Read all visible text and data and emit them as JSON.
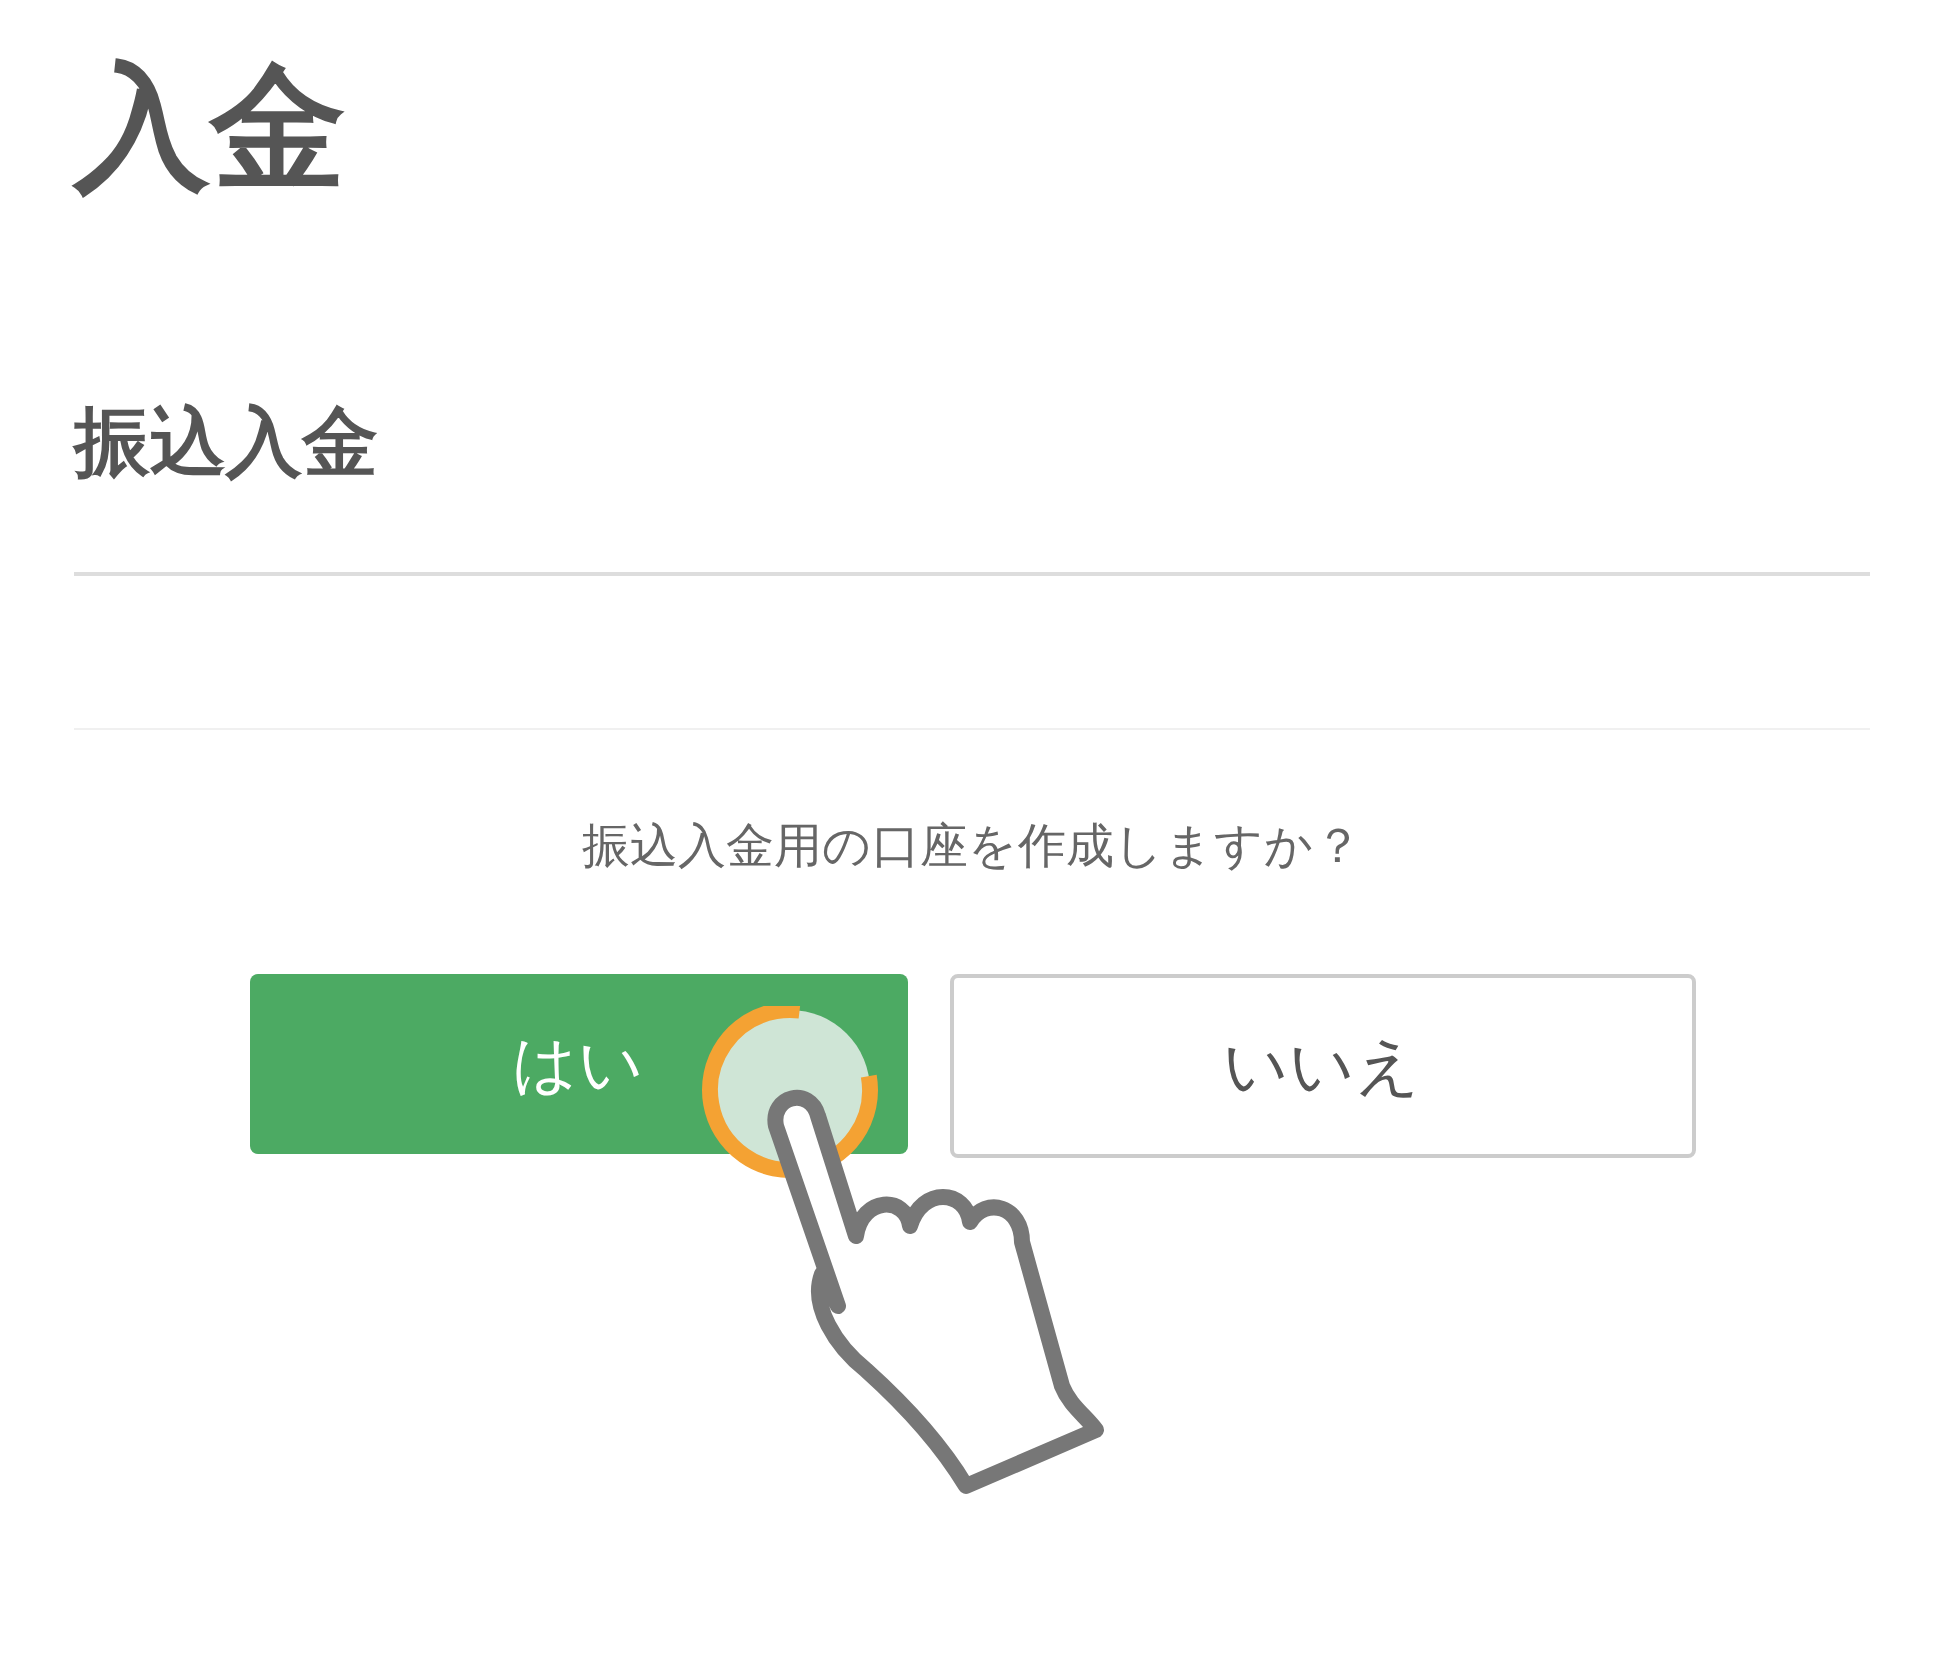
{
  "title": "入金",
  "section_title": "振込入金",
  "question": "振込入金用の口座を作成しますか？",
  "buttons": [
    {
      "label": "はい",
      "kind": "primary"
    },
    {
      "label": "いいえ",
      "kind": "secondary"
    }
  ]
}
